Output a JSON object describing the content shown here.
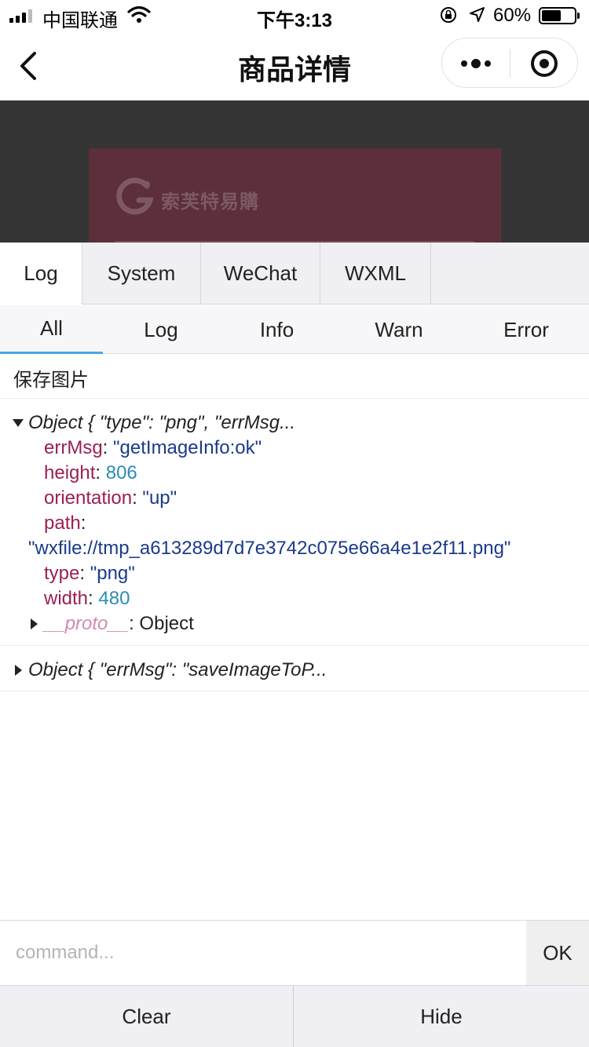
{
  "status_bar": {
    "carrier": "中国联通",
    "time": "下午3:13",
    "battery_percent": "60%",
    "battery_level": 0.6
  },
  "nav": {
    "title": "商品详情"
  },
  "background_page": {
    "brand_text": "索芙特易購"
  },
  "console": {
    "main_tabs": [
      {
        "label": "Log",
        "active": true
      },
      {
        "label": "System",
        "active": false
      },
      {
        "label": "WeChat",
        "active": false
      },
      {
        "label": "WXML",
        "active": false
      }
    ],
    "filter_tabs": [
      {
        "label": "All",
        "active": true
      },
      {
        "label": "Log",
        "active": false
      },
      {
        "label": "Info",
        "active": false
      },
      {
        "label": "Warn",
        "active": false
      },
      {
        "label": "Error",
        "active": false
      }
    ],
    "logs": {
      "entry1": "保存图片",
      "entry2": {
        "summary": "Object { \"type\": \"png\", \"errMsg...",
        "props": [
          {
            "key": "errMsg",
            "value": "\"getImageInfo:ok\""
          },
          {
            "key": "height",
            "value": "806"
          },
          {
            "key": "orientation",
            "value": "\"up\""
          },
          {
            "key": "path",
            "value": "\"wxfile://tmp_a613289d7d7e3742c075e66a4e1e2f11.png\""
          },
          {
            "key": "type",
            "value": "\"png\""
          },
          {
            "key": "width",
            "value": "480"
          }
        ],
        "proto_key": "__proto__",
        "proto_value": ": Object"
      },
      "entry3": {
        "summary": "Object { \"errMsg\": \"saveImageToP..."
      }
    },
    "command": {
      "placeholder": "command...",
      "submit_label": "OK"
    },
    "actions": {
      "clear_label": "Clear",
      "hide_label": "Hide"
    }
  }
}
